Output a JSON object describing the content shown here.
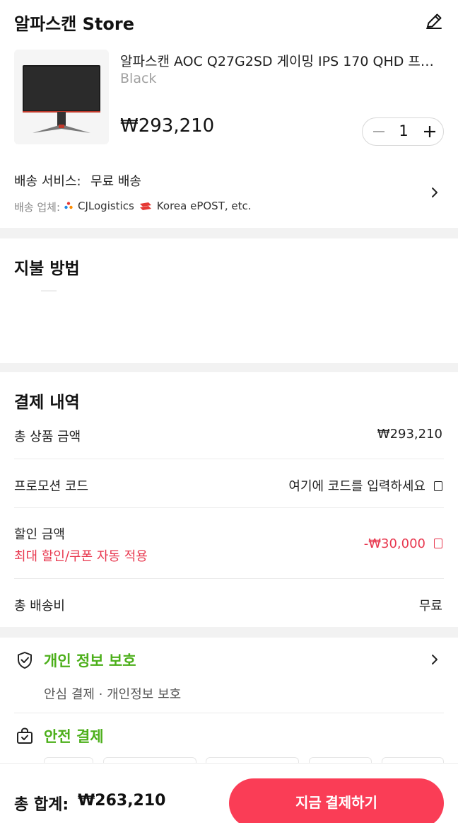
{
  "store": {
    "title": "알파스캔 Store",
    "product": {
      "name": "알파스캔 AOC Q27G2SD 게이밍 IPS 170 QHD 프리싱...",
      "variant": "Black",
      "price": "₩293,210",
      "quantity": "1"
    },
    "shipping": {
      "service_label": "배송 서비스:",
      "service_value": "무료 배송",
      "carrier_label": "배송 업체:",
      "carriers": [
        "CJLogistics",
        "Korea ePOST, etc."
      ]
    }
  },
  "payment_method": {
    "title": "지불 방법"
  },
  "summary": {
    "title": "결제 내역",
    "subtotal_label": "총 상품 금액",
    "subtotal_value": "₩293,210",
    "promo_label": "프로모션 코드",
    "promo_placeholder": "여기에 코드를 입력하세요",
    "discount_label": "할인 금액",
    "discount_sub": "최대 할인/쿠폰 자동 적용",
    "discount_value": "-₩30,000",
    "shipping_label": "총 배송비",
    "shipping_value": "무료"
  },
  "trust": {
    "privacy_title": "개인 정보 보호",
    "privacy_desc": "안심 결제 · 개인정보 보호",
    "secure_title": "안전 결제"
  },
  "footer": {
    "total_label": "총 합계:",
    "total_value": "₩263,210",
    "pay_button": "지금 결제하기"
  },
  "colors": {
    "accent": "#fa3d56",
    "discount": "#e8384f",
    "trust_green": "#4caf1a"
  }
}
